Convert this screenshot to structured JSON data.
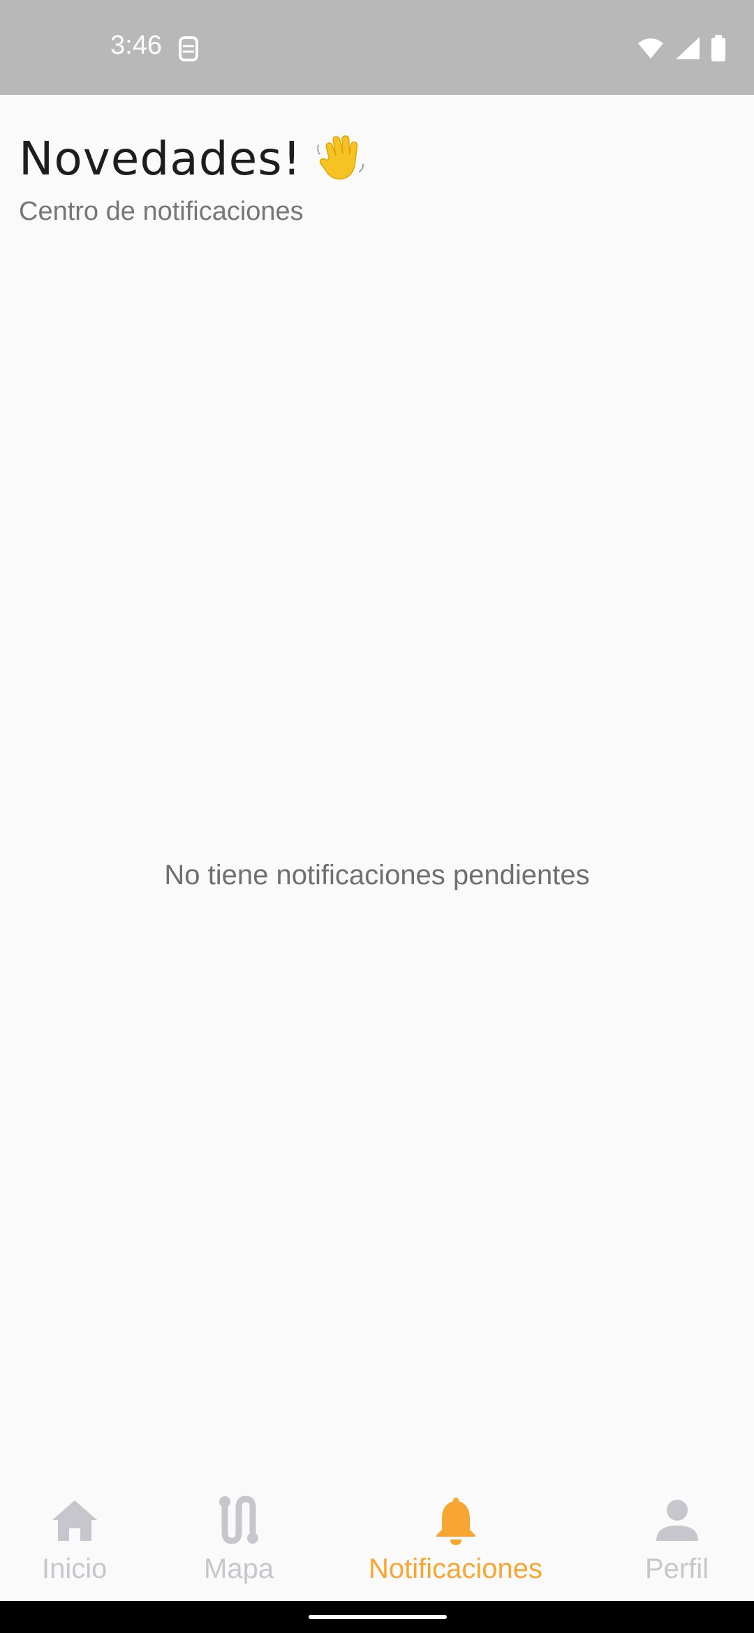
{
  "status_bar": {
    "time": "3:46"
  },
  "header": {
    "title": "Novedades!",
    "subtitle": "Centro de notificaciones"
  },
  "main": {
    "empty_message": "No tiene notificaciones pendientes"
  },
  "bottom_nav": {
    "items": [
      {
        "label": "Inicio",
        "icon": "home-icon",
        "active": false
      },
      {
        "label": "Mapa",
        "icon": "route-icon",
        "active": false
      },
      {
        "label": "Notificaciones",
        "icon": "bell-icon",
        "active": true
      },
      {
        "label": "Perfil",
        "icon": "person-icon",
        "active": false
      }
    ]
  },
  "colors": {
    "accent": "#f8a631",
    "inactive": "#c6c6cc",
    "background": "#fafafa",
    "status_bar": "#b8b8b8"
  }
}
